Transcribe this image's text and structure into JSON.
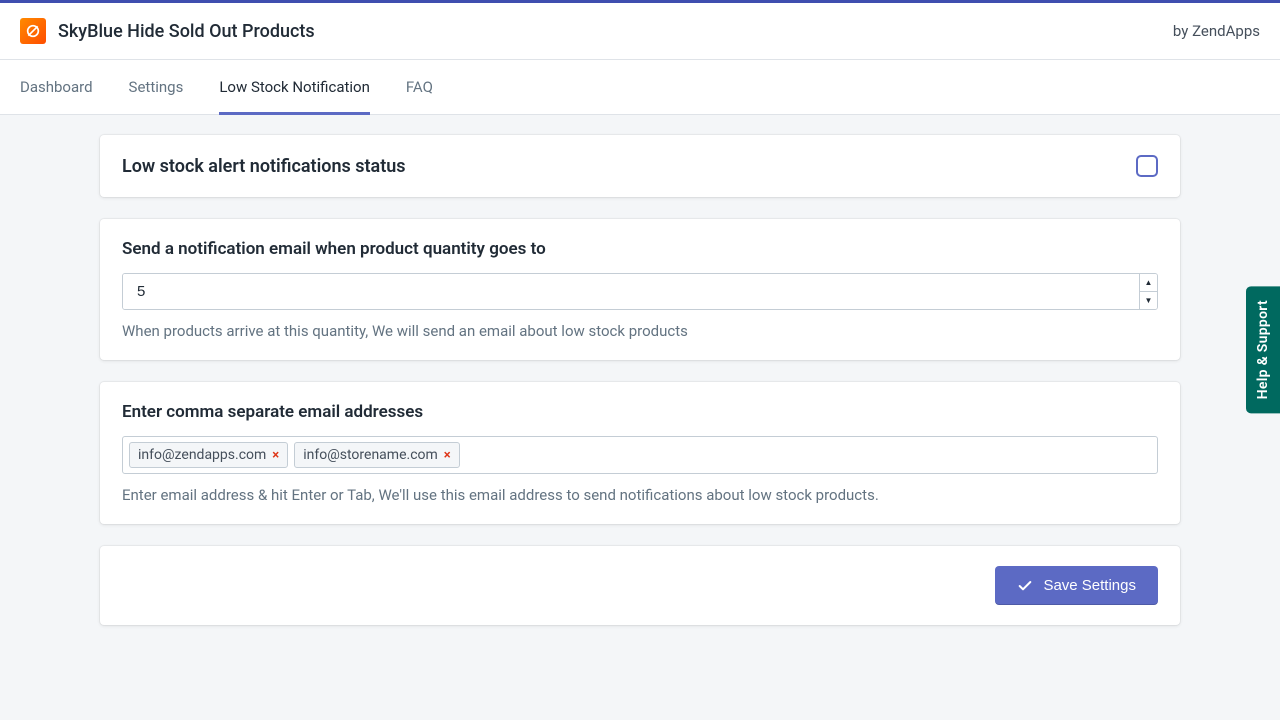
{
  "header": {
    "app_title": "SkyBlue Hide Sold Out Products",
    "by": "by ZendApps"
  },
  "tabs": [
    {
      "label": "Dashboard",
      "active": false
    },
    {
      "label": "Settings",
      "active": false
    },
    {
      "label": "Low Stock Notification",
      "active": true
    },
    {
      "label": "FAQ",
      "active": false
    }
  ],
  "status_card": {
    "title": "Low stock alert notifications status",
    "enabled": false
  },
  "threshold_card": {
    "title": "Send a notification email when product quantity goes to",
    "value": "5",
    "hint": "When products arrive at this quantity, We will send an email about low stock products"
  },
  "emails_card": {
    "title": "Enter comma separate email addresses",
    "tags": [
      "info@zendapps.com",
      "info@storename.com"
    ],
    "hint": "Enter email address & hit Enter or Tab, We'll use this email address to send notifications about low stock products."
  },
  "save": {
    "label": "Save Settings"
  },
  "help": {
    "label": "Help & Support"
  }
}
